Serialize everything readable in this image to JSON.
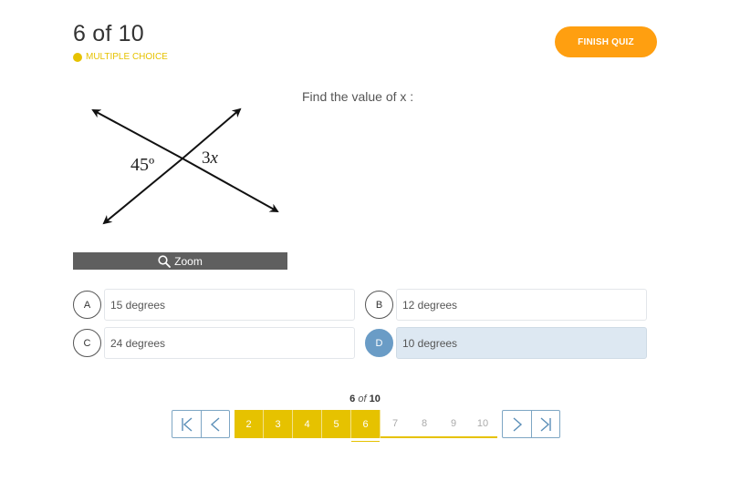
{
  "header": {
    "counter": "6 of 10",
    "question_type": "MULTIPLE CHOICE",
    "finish_label": "FINISH QUIZ"
  },
  "figure": {
    "label_left": "45º",
    "label_right_num": "3",
    "label_right_var": "x",
    "zoom_label": "Zoom"
  },
  "question": {
    "prompt": "Find the value of x :"
  },
  "answers": [
    {
      "letter": "A",
      "text": "15 degrees",
      "selected": false
    },
    {
      "letter": "B",
      "text": "12 degrees",
      "selected": false
    },
    {
      "letter": "C",
      "text": "24 degrees",
      "selected": false
    },
    {
      "letter": "D",
      "text": "10 degrees",
      "selected": true
    }
  ],
  "pager": {
    "current": "6",
    "of": "of",
    "total": "10",
    "pages": [
      "2",
      "3",
      "4",
      "5",
      "6",
      "7",
      "8",
      "9",
      "10"
    ]
  },
  "colors": {
    "accent_yellow": "#e6c200",
    "finish_orange": "#ff9f10",
    "selected_blue": "#6a9cc6",
    "selected_bg": "#dde8f2"
  }
}
